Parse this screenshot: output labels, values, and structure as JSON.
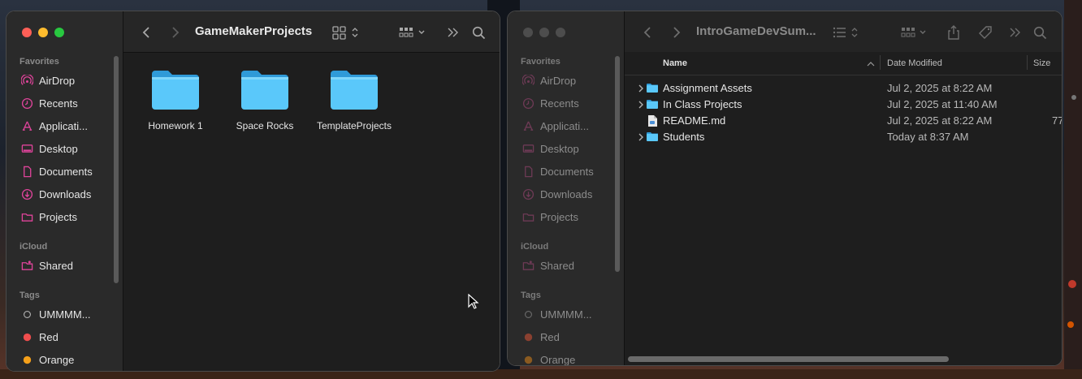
{
  "left_window": {
    "title": "GameMakerProjects",
    "sidebar": {
      "favorites_header": "Favorites",
      "favorites": [
        {
          "label": "AirDrop",
          "icon": "airdrop-icon"
        },
        {
          "label": "Recents",
          "icon": "clock-icon"
        },
        {
          "label": "Applicati...",
          "icon": "applications-icon"
        },
        {
          "label": "Desktop",
          "icon": "desktop-icon"
        },
        {
          "label": "Documents",
          "icon": "document-icon"
        },
        {
          "label": "Downloads",
          "icon": "download-icon"
        },
        {
          "label": "Projects",
          "icon": "folder-icon"
        }
      ],
      "icloud_header": "iCloud",
      "icloud": [
        {
          "label": "Shared",
          "icon": "shared-folder-icon"
        }
      ],
      "tags_header": "Tags",
      "tags": [
        {
          "label": "UMMMM...",
          "color": "none"
        },
        {
          "label": "Red",
          "color": "#ef4d4d"
        },
        {
          "label": "Orange",
          "color": "#f5a01a"
        }
      ]
    },
    "items": [
      {
        "label": "Homework 1"
      },
      {
        "label": "Space Rocks"
      },
      {
        "label": "TemplateProjects"
      }
    ]
  },
  "right_window": {
    "title": "IntroGameDevSum...",
    "sidebar": {
      "favorites_header": "Favorites",
      "favorites": [
        {
          "label": "AirDrop"
        },
        {
          "label": "Recents"
        },
        {
          "label": "Applicati..."
        },
        {
          "label": "Desktop"
        },
        {
          "label": "Documents"
        },
        {
          "label": "Downloads"
        },
        {
          "label": "Projects"
        }
      ],
      "icloud_header": "iCloud",
      "icloud": [
        {
          "label": "Shared"
        }
      ],
      "tags_header": "Tags",
      "tags": [
        {
          "label": "UMMMM..."
        },
        {
          "label": "Red",
          "color": "#8a4030"
        },
        {
          "label": "Orange",
          "color": "#8a5a20"
        }
      ]
    },
    "columns": {
      "name": "Name",
      "date": "Date Modified",
      "size": "Size"
    },
    "rows": [
      {
        "name": "Assignment Assets",
        "date": "Jul 2, 2025 at 8:22 AM",
        "size": "",
        "kind": "folder"
      },
      {
        "name": "In Class Projects",
        "date": "Jul 2, 2025 at 11:40 AM",
        "size": "",
        "kind": "folder"
      },
      {
        "name": "README.md",
        "date": "Jul 2, 2025 at 8:22 AM",
        "size": "77",
        "kind": "file"
      },
      {
        "name": "Students",
        "date": "Today at 8:37 AM",
        "size": "",
        "kind": "folder"
      }
    ]
  },
  "colors": {
    "accent_pink": "#e0449b",
    "folder_blue": "#5ac8fa",
    "traffic_red": "#fe5f57",
    "traffic_yellow": "#febc2e",
    "traffic_green": "#28c840"
  }
}
